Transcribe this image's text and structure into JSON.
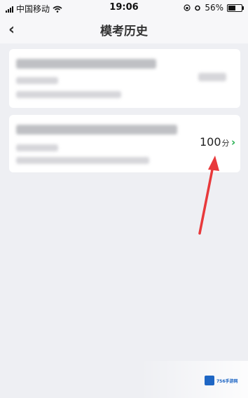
{
  "status_bar": {
    "carrier": "中国移动",
    "time": "19:06",
    "battery": "56%",
    "battery_level": 0.56,
    "icons": [
      "signal-icon",
      "wifi-icon",
      "lock-rotation-icon",
      "alarm-icon",
      "battery-icon"
    ]
  },
  "nav": {
    "back_icon": "chevron-left-icon",
    "back_glyph": "‹",
    "title": "模考历史"
  },
  "records": [
    {
      "title": "",
      "subtitle": "",
      "detail": "",
      "score": ""
    },
    {
      "title": "",
      "subtitle": "",
      "detail": "",
      "score": "100",
      "score_unit": "分",
      "chevron_glyph": "›"
    }
  ],
  "colors": {
    "background": "#eeeff3",
    "accent_green": "#1fae4b",
    "arrow_red": "#e8393b"
  },
  "watermark": {
    "text": "756手游网"
  }
}
